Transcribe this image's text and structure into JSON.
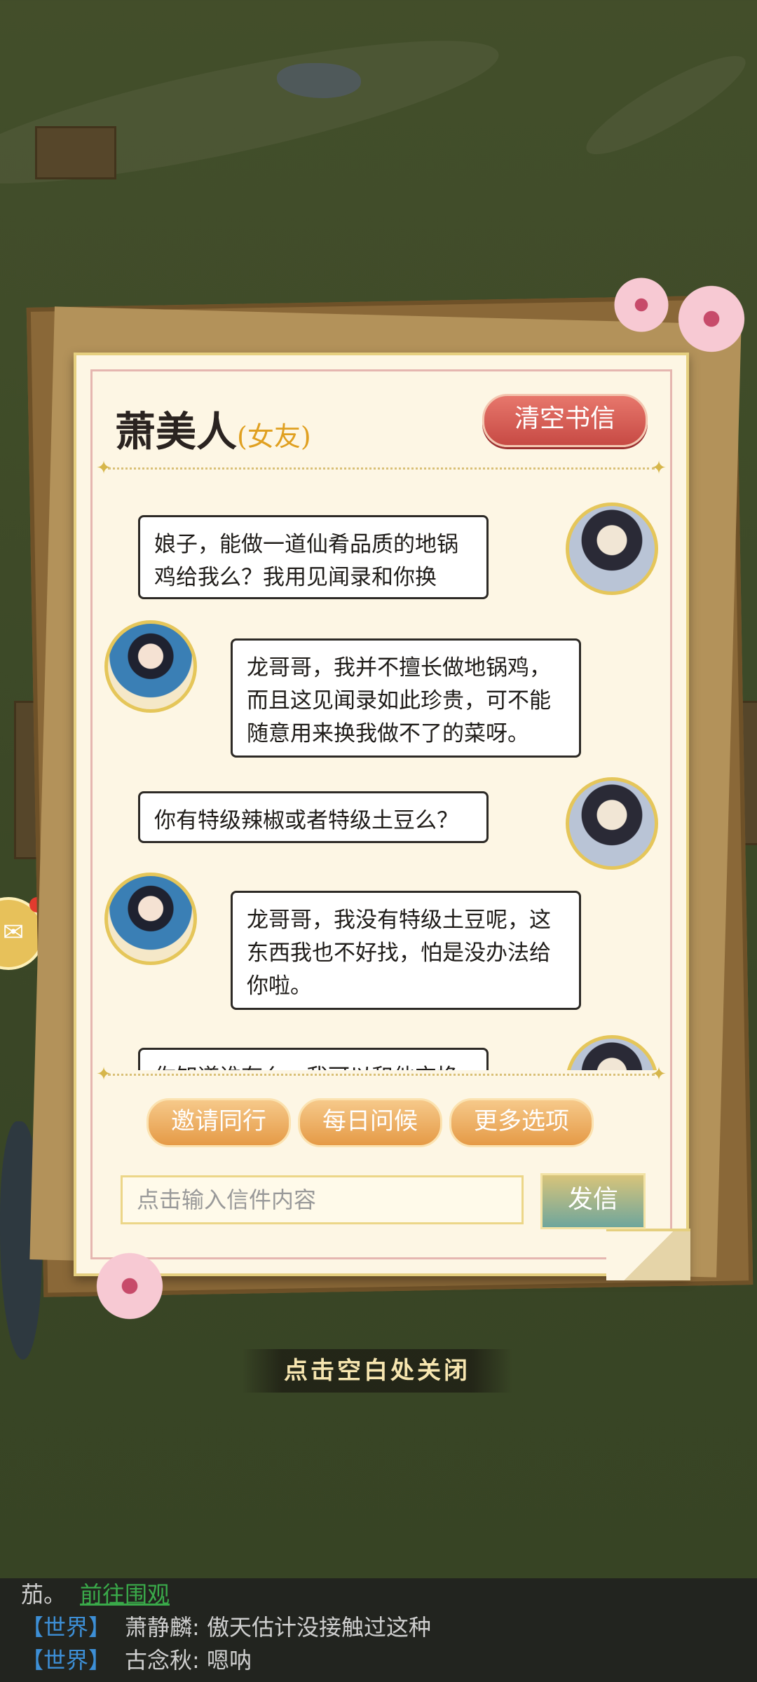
{
  "letter": {
    "name": "萧美人",
    "relation": "(女友)",
    "clear_button": "清空书信",
    "messages": [
      {
        "side": "right",
        "speaker": "male",
        "text": "娘子，能做一道仙肴品质的地锅鸡给我么？我用见闻录和你换"
      },
      {
        "side": "left",
        "speaker": "female",
        "text": "龙哥哥，我并不擅长做地锅鸡，而且这见闻录如此珍贵，可不能随意用来换我做不了的菜呀。"
      },
      {
        "side": "right",
        "speaker": "male",
        "text": "你有特级辣椒或者特级土豆么？"
      },
      {
        "side": "left",
        "speaker": "female",
        "text": "龙哥哥，我没有特级土豆呢，这东西我也不好找，怕是没办法给你啦。"
      },
      {
        "side": "right",
        "speaker": "male",
        "text": "你知道谁有么，我可以和他交换"
      }
    ],
    "options": [
      "邀请同行",
      "每日问候",
      "更多选项"
    ],
    "input_placeholder": "点击输入信件内容",
    "send_button": "发信"
  },
  "close_hint": "点击空白处关闭",
  "world_chat": {
    "partial": "茄。",
    "partial_link": "前往围观",
    "lines": [
      {
        "tag": "【世界】",
        "user": "萧静麟",
        "text": "傲天估计没接触过这种"
      },
      {
        "tag": "【世界】",
        "user": "古念秋",
        "text": "嗯呐"
      }
    ]
  },
  "colors": {
    "accent_red": "#c74a44",
    "gold": "#e5c65a",
    "link_green": "#3aaa4a",
    "tag_blue": "#3d8fd6"
  }
}
